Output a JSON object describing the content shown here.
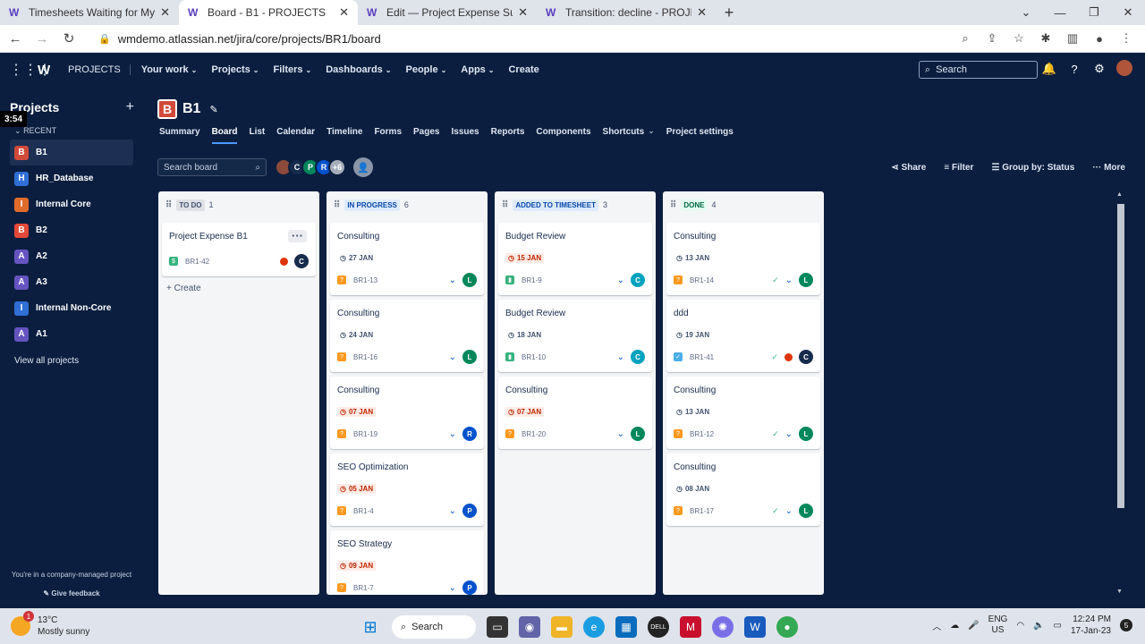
{
  "browser": {
    "tabs": [
      {
        "title": "Timesheets Waiting for My Appro",
        "active": false
      },
      {
        "title": "Board - B1 - PROJECTS",
        "active": true
      },
      {
        "title": "Edit — Project Expense Submissio",
        "active": false
      },
      {
        "title": "Transition: decline - PROJECTS",
        "active": false
      }
    ],
    "url": "wmdemo.atlassian.net/jira/core/projects/BR1/board"
  },
  "topnav": {
    "brand": "PROJECTS",
    "menus": [
      "Your work",
      "Projects",
      "Filters",
      "Dashboards",
      "People",
      "Apps"
    ],
    "create": "Create",
    "search_placeholder": "Search"
  },
  "sidebar": {
    "title": "Projects",
    "recent_label": "RECENT",
    "items": [
      {
        "label": "B1",
        "color": "#d14a3a",
        "letter": "B",
        "active": true
      },
      {
        "label": "HR_Database",
        "color": "#2f6fd6",
        "letter": "H",
        "active": false
      },
      {
        "label": "Internal Core",
        "color": "#e06c2c",
        "letter": "I",
        "active": false
      },
      {
        "label": "B2",
        "color": "#e5493a",
        "letter": "B",
        "active": false
      },
      {
        "label": "A2",
        "color": "#6554c0",
        "letter": "A",
        "active": false
      },
      {
        "label": "A3",
        "color": "#6554c0",
        "letter": "A",
        "active": false
      },
      {
        "label": "Internal Non-Core",
        "color": "#2f6fd6",
        "letter": "I",
        "active": false
      },
      {
        "label": "A1",
        "color": "#6554c0",
        "letter": "A",
        "active": false
      }
    ],
    "view_all": "View all projects",
    "footer_note": "You're in a company-managed project",
    "feedback": "Give feedback",
    "timer": "3:54"
  },
  "project": {
    "name": "B1",
    "tabs": [
      "Summary",
      "Board",
      "List",
      "Calendar",
      "Timeline",
      "Forms",
      "Pages",
      "Issues",
      "Reports",
      "Components",
      "Shortcuts",
      "Project settings"
    ],
    "active_tab": "Board"
  },
  "toolbar": {
    "search_placeholder": "Search board",
    "avatars": [
      {
        "letter": "",
        "color": "#8b4a3a"
      },
      {
        "letter": "C",
        "color": "#172b4d"
      },
      {
        "letter": "P",
        "color": "#00875a"
      },
      {
        "letter": "R",
        "color": "#0052cc"
      },
      {
        "letter": "+6",
        "color": "#a5adba"
      }
    ],
    "share": "Share",
    "filter": "Filter",
    "group_by": "Group by: Status",
    "more": "More"
  },
  "columns": [
    {
      "name": "TO DO",
      "count": "1",
      "status_bg": "#dfe1e6",
      "status_fg": "#42526e",
      "cards": [
        {
          "title": "Project Expense B1",
          "date": "",
          "date_red": false,
          "key": "BR1-42",
          "type_color": "#36b37e",
          "type_glyph": "$",
          "check": false,
          "blocked": true,
          "priority": false,
          "assignee": "C",
          "assignee_color": "#172b4d",
          "menu": true
        }
      ],
      "create": "Create"
    },
    {
      "name": "IN PROGRESS",
      "count": "6",
      "status_bg": "#deebff",
      "status_fg": "#0747a6",
      "cards": [
        {
          "title": "Consulting",
          "date": "27 JAN",
          "date_red": false,
          "key": "BR1-13",
          "type_color": "#ff991f",
          "type_glyph": "?",
          "check": false,
          "blocked": false,
          "priority": true,
          "assignee": "L",
          "assignee_color": "#00875a"
        },
        {
          "title": "Consulting",
          "date": "24 JAN",
          "date_red": false,
          "key": "BR1-16",
          "type_color": "#ff991f",
          "type_glyph": "?",
          "check": false,
          "blocked": false,
          "priority": true,
          "assignee": "L",
          "assignee_color": "#00875a"
        },
        {
          "title": "Consulting",
          "date": "07 JAN",
          "date_red": true,
          "key": "BR1-19",
          "type_color": "#ff991f",
          "type_glyph": "?",
          "check": false,
          "blocked": false,
          "priority": true,
          "assignee": "R",
          "assignee_color": "#0052cc"
        },
        {
          "title": "SEO Optimization",
          "date": "05 JAN",
          "date_red": true,
          "key": "BR1-4",
          "type_color": "#ff991f",
          "type_glyph": "?",
          "check": false,
          "blocked": false,
          "priority": true,
          "assignee": "P",
          "assignee_color": "#0052cc"
        },
        {
          "title": "SEO Strategy",
          "date": "09 JAN",
          "date_red": true,
          "key": "BR1-7",
          "type_color": "#ff991f",
          "type_glyph": "?",
          "check": false,
          "blocked": false,
          "priority": true,
          "assignee": "P",
          "assignee_color": "#0052cc"
        }
      ]
    },
    {
      "name": "ADDED TO TIMESHEET",
      "count": "3",
      "status_bg": "#deebff",
      "status_fg": "#0747a6",
      "cards": [
        {
          "title": "Budget Review",
          "date": "15 JAN",
          "date_red": true,
          "key": "BR1-9",
          "type_color": "#36b37e",
          "type_glyph": "▮",
          "check": false,
          "blocked": false,
          "priority": true,
          "assignee": "C",
          "assignee_color": "#00a3bf"
        },
        {
          "title": "Budget Review",
          "date": "18 JAN",
          "date_red": false,
          "key": "BR1-10",
          "type_color": "#36b37e",
          "type_glyph": "▮",
          "check": false,
          "blocked": false,
          "priority": true,
          "assignee": "C",
          "assignee_color": "#00a3bf"
        },
        {
          "title": "Consulting",
          "date": "07 JAN",
          "date_red": true,
          "key": "BR1-20",
          "type_color": "#ff991f",
          "type_glyph": "?",
          "check": false,
          "blocked": false,
          "priority": true,
          "assignee": "L",
          "assignee_color": "#00875a"
        }
      ]
    },
    {
      "name": "DONE",
      "count": "4",
      "status_bg": "#e3fcef",
      "status_fg": "#006644",
      "cards": [
        {
          "title": "Consulting",
          "date": "13 JAN",
          "date_red": false,
          "key": "BR1-14",
          "type_color": "#ff991f",
          "type_glyph": "?",
          "check": true,
          "blocked": false,
          "priority": true,
          "assignee": "L",
          "assignee_color": "#00875a"
        },
        {
          "title": "ddd",
          "date": "19 JAN",
          "date_red": false,
          "key": "BR1-41",
          "type_color": "#4bade8",
          "type_glyph": "✓",
          "check": true,
          "blocked": true,
          "priority": false,
          "assignee": "C",
          "assignee_color": "#172b4d"
        },
        {
          "title": "Consulting",
          "date": "13 JAN",
          "date_red": false,
          "key": "BR1-12",
          "type_color": "#ff991f",
          "type_glyph": "?",
          "check": true,
          "blocked": false,
          "priority": true,
          "assignee": "L",
          "assignee_color": "#00875a"
        },
        {
          "title": "Consulting",
          "date": "08 JAN",
          "date_red": false,
          "key": "BR1-17",
          "type_color": "#ff991f",
          "type_glyph": "?",
          "check": true,
          "blocked": false,
          "priority": true,
          "assignee": "L",
          "assignee_color": "#00875a"
        }
      ]
    }
  ],
  "taskbar": {
    "temperature": "13°C",
    "weather": "Mostly sunny",
    "weather_badge": "1",
    "search": "Search",
    "lang_line1": "ENG",
    "lang_line2": "US",
    "time": "12:24 PM",
    "date": "17-Jan-23",
    "notifications": "5"
  }
}
